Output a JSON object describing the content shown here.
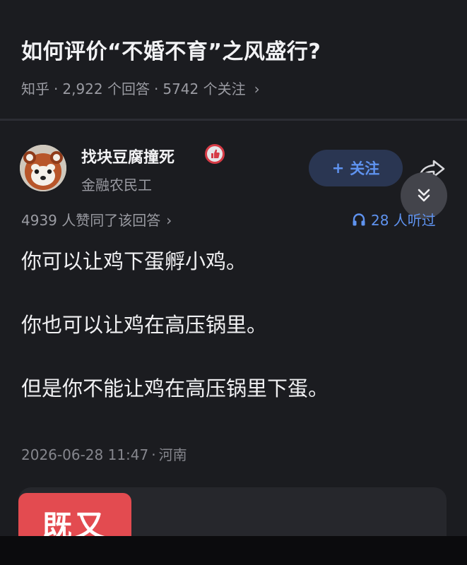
{
  "question": {
    "title": "如何评价“不婚不育”之风盛行?",
    "source": "知乎",
    "answers": "2,922 个回答",
    "followers": "5742 个关注",
    "separator": "·",
    "chevron": "›"
  },
  "author": {
    "name": "找块豆腐撞死",
    "subtitle": "金融农民工",
    "badge_icon": "thumbs-up-badge-icon",
    "follow_label": "关注",
    "follow_plus": "+"
  },
  "answer": {
    "likes_text": "4939 人赞同了该回答",
    "chevron": "›",
    "listen_text": "28 人听过",
    "lines": [
      "你可以让鸡下蛋孵小鸡。",
      "你也可以让鸡在高压锅里。",
      "但是你不能让鸡在高压锅里下蛋。"
    ],
    "date": "2026-06-28 11:47",
    "separator": "·",
    "location": "河南"
  },
  "sticker": {
    "text": "既又"
  },
  "colors": {
    "background": "#1b1c20",
    "accent_blue": "#5f93f0",
    "muted": "#9a9ba2",
    "sticker_red": "#e34b50"
  }
}
